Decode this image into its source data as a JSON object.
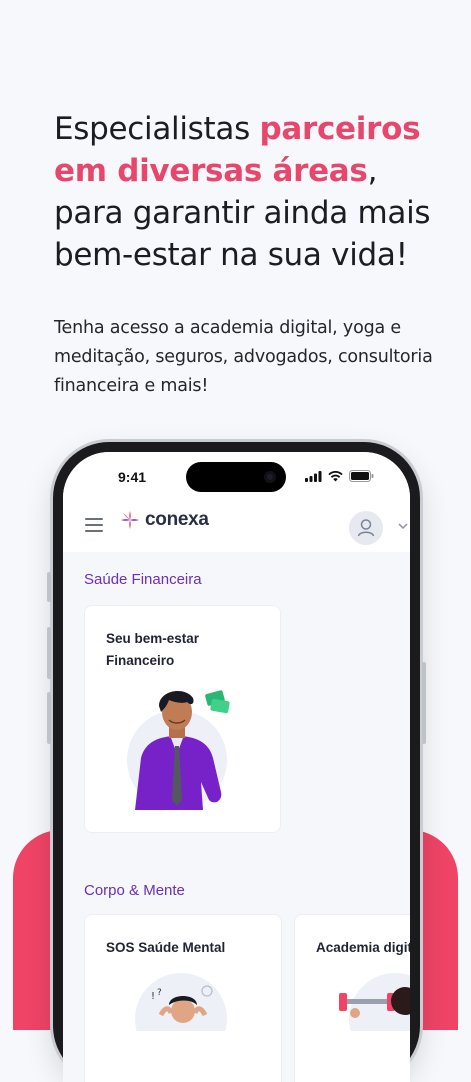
{
  "headline": {
    "part1": "Especialistas ",
    "highlight": "parceiros em diversas áreas",
    "part2": ", para garantir ainda mais bem-estar na sua vida!"
  },
  "subtext": "Tenha acesso a academia digital, yoga e meditação, seguros, advogados, consultoria financeira e mais!",
  "phone": {
    "time": "9:41",
    "logo_text": "conexa",
    "sections": [
      {
        "title": "Saúde Financeira",
        "cards": [
          {
            "title": "Seu bem-estar Financeiro"
          }
        ]
      },
      {
        "title": "Corpo & Mente",
        "cards": [
          {
            "title": "SOS Saúde Mental"
          },
          {
            "title": "Academia digital"
          }
        ]
      }
    ]
  },
  "colors": {
    "accent": "#e8476c",
    "brand_purple": "#6b2fb8",
    "footer_pink": "#ef4466"
  },
  "icons": [
    "menu-icon",
    "conexa-logo-icon",
    "user-icon",
    "chevron-down-icon",
    "signal-icon",
    "wifi-icon",
    "battery-icon"
  ]
}
